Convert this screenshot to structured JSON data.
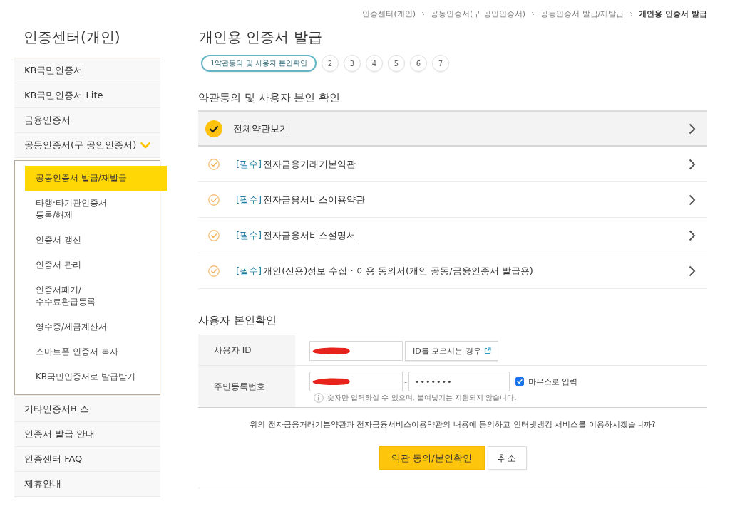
{
  "breadcrumb": [
    {
      "label": "인증센터(개인)",
      "current": false
    },
    {
      "label": "공동인증서(구 공인인증서)",
      "current": false
    },
    {
      "label": "공동인증서 발급/재발급",
      "current": false
    },
    {
      "label": "개인용 인증서 발급",
      "current": true
    }
  ],
  "sidebar": {
    "title": "인증센터(개인)",
    "items": [
      {
        "label": "KB국민인증서",
        "expanded": false
      },
      {
        "label": "KB국민인증서 Lite",
        "expanded": false
      },
      {
        "label": "금융인증서",
        "expanded": false
      },
      {
        "label": "공동인증서(구 공인인증서)",
        "expanded": true,
        "children": [
          {
            "label": "공동인증서 발급/재발급",
            "selected": true
          },
          {
            "label": "타행·타기관인증서\n등록/해제",
            "selected": false
          },
          {
            "label": "인증서 갱신",
            "selected": false
          },
          {
            "label": "인증서 관리",
            "selected": false
          },
          {
            "label": "인증서폐기/\n수수료환급등록",
            "selected": false
          },
          {
            "label": "영수증/세금계산서",
            "selected": false
          },
          {
            "label": "스마트폰 인증서 복사",
            "selected": false
          },
          {
            "label": "KB국민인증서로 발급받기",
            "selected": false
          }
        ]
      },
      {
        "label": "기타인증서비스",
        "expanded": false
      },
      {
        "label": "인증서 발급 안내",
        "expanded": false
      },
      {
        "label": "인증센터 FAQ",
        "expanded": false
      },
      {
        "label": "제휴안내",
        "expanded": false
      }
    ]
  },
  "page_title": "개인용 인증서 발급",
  "steps": [
    {
      "label": "1약관동의 및 사용자 본인확인",
      "selected": true
    },
    {
      "label": "2",
      "selected": false
    },
    {
      "label": "3",
      "selected": false
    },
    {
      "label": "4",
      "selected": false
    },
    {
      "label": "5",
      "selected": false
    },
    {
      "label": "6",
      "selected": false
    },
    {
      "label": "7",
      "selected": false
    }
  ],
  "terms": {
    "heading": "약관동의 및 사용자 본인 확인",
    "items": [
      {
        "kind": "all",
        "label": "전체약관보기",
        "checked": true
      },
      {
        "kind": "required",
        "tag": "[필수]",
        "label": "전자금융거래기본약관",
        "checked": false
      },
      {
        "kind": "required",
        "tag": "[필수]",
        "label": "전자금융서비스이용약관",
        "checked": false
      },
      {
        "kind": "required",
        "tag": "[필수]",
        "label": "전자금융서비스설명서",
        "checked": false
      },
      {
        "kind": "required",
        "tag": "[필수]",
        "label": "개인(신용)정보 수집 · 이용 동의서(개인 공동/금융인증서 발급용)",
        "checked": false
      }
    ]
  },
  "identity": {
    "heading": "사용자 본인확인",
    "rows": [
      {
        "label": "사용자 ID",
        "fields": [
          {
            "redacted": true
          }
        ],
        "button": {
          "label": "ID를 모르시는 경우"
        }
      },
      {
        "label": "주민등록번호",
        "fields": [
          {
            "redacted": true
          },
          {
            "value": "•••••••",
            "redacted": false
          }
        ],
        "separator": "-",
        "checkbox": {
          "label": "마우스로 입력",
          "checked": true
        },
        "note": "숫자만 입력하실 수 있으며, 붙여넣기는 지원되지 않습니다."
      }
    ]
  },
  "confirm": {
    "question": "위의 전자금융거래기본약관과 전자금융서비스이용약관의 내용에 동의하고 인터넷뱅킹 서비스를 이용하시겠습니까?",
    "buttons": [
      {
        "label": "약관 동의/본인확인",
        "kind": "primary"
      },
      {
        "label": "취소",
        "kind": "secondary"
      }
    ]
  }
}
